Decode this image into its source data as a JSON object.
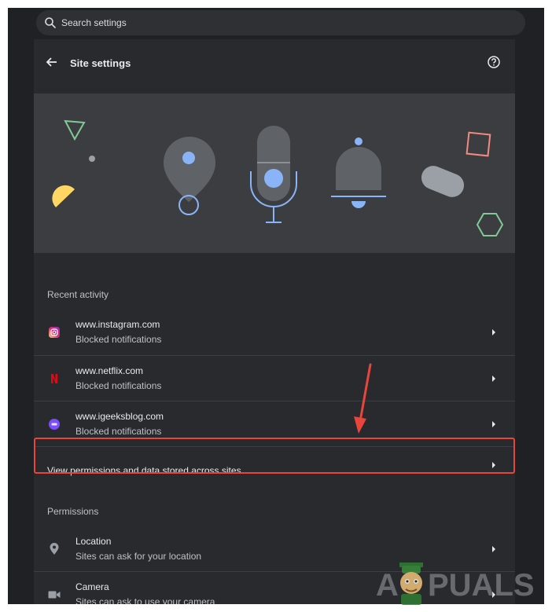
{
  "search": {
    "placeholder": "Search settings",
    "icon": "search-icon"
  },
  "header": {
    "title": "Site settings",
    "back_icon": "arrow-back-icon",
    "help_icon": "help-circle-icon"
  },
  "recent_activity": {
    "heading": "Recent activity",
    "items": [
      {
        "site": "www.instagram.com",
        "status": "Blocked notifications",
        "icon": "instagram-favicon"
      },
      {
        "site": "www.netflix.com",
        "status": "Blocked notifications",
        "icon": "netflix-favicon"
      },
      {
        "site": "www.igeeksblog.com",
        "status": "Blocked notifications",
        "icon": "igeeksblog-favicon"
      }
    ]
  },
  "view_all": {
    "label": "View permissions and data stored across sites"
  },
  "permissions": {
    "heading": "Permissions",
    "items": [
      {
        "title": "Location",
        "subtitle": "Sites can ask for your location",
        "icon": "location-pin-icon"
      },
      {
        "title": "Camera",
        "subtitle": "Sites can ask to use your camera",
        "icon": "camera-icon"
      }
    ]
  },
  "annotation": {
    "color": "#e8453c"
  },
  "watermark": {
    "text": "A PUALS"
  },
  "colors": {
    "background": "#202124",
    "panel": "#292a2d",
    "banner": "#3c3d40",
    "accent_blue": "#8ab4f8",
    "text": "#e8eaed"
  }
}
